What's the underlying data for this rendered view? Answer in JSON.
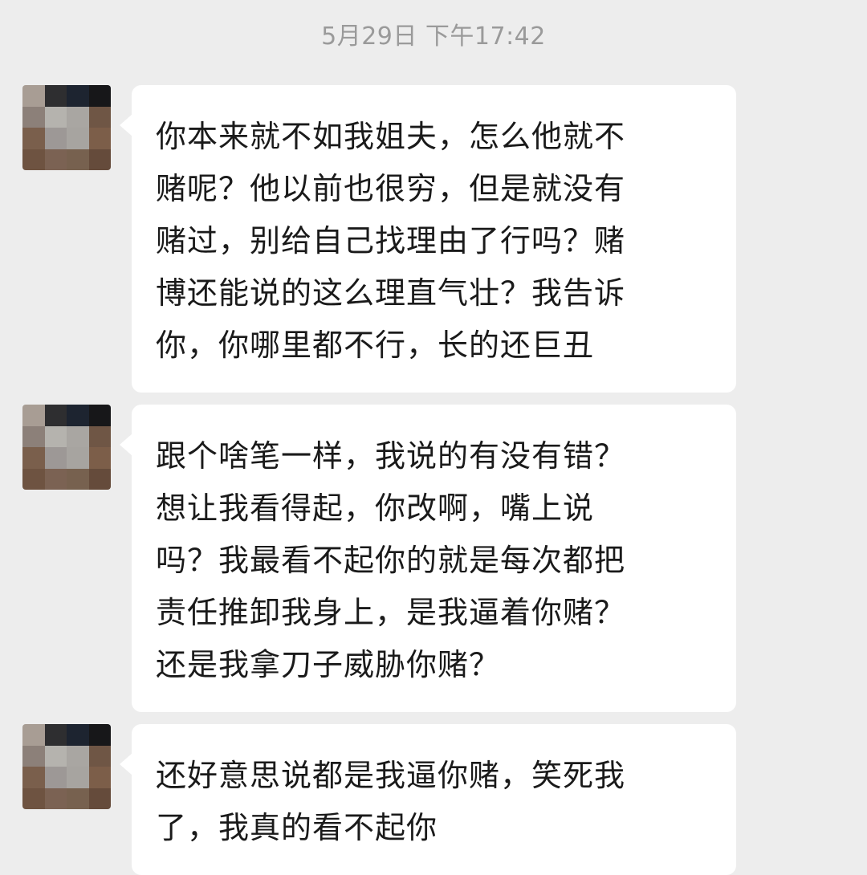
{
  "chat": {
    "timestamp": "5月29日 下午17:42",
    "messages": [
      {
        "text": "你本来就不如我姐夫，怎么他就不\n赌呢？他以前也很穷，但是就没有\n赌过，别给自己找理由了行吗？赌\n博还能说的这么理直气壮？我告诉\n你，你哪里都不行，长的还巨丑"
      },
      {
        "text": "跟个啥笔一样，我说的有没有错？\n想让我看得起，你改啊，嘴上说\n吗？我最看不起你的就是每次都把\n责任推卸我身上，是我逼着你赌？\n还是我拿刀子威胁你赌？"
      },
      {
        "text": "还好意思说都是我逼你赌，笑死我\n了，我真的看不起你"
      }
    ]
  },
  "colors": {
    "background": "#ededed",
    "bubble": "#ffffff",
    "text": "#1a1a1a",
    "timestamp": "#9a9a9a"
  }
}
